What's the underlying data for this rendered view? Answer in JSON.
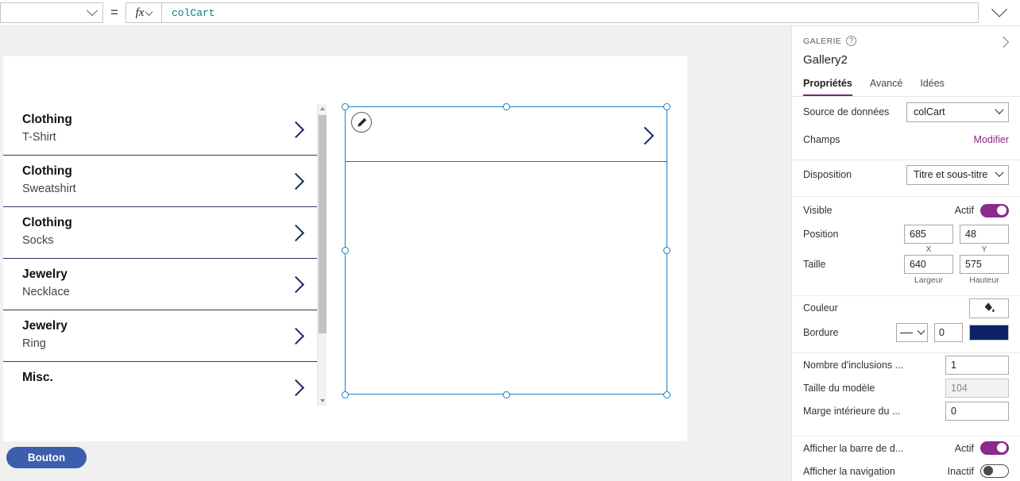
{
  "formula_bar": {
    "property_selector_value": "",
    "equals_sign": "=",
    "fx_label": "fx",
    "formula_value": "colCart",
    "expand_icon": "chevron-down-icon"
  },
  "canvas": {
    "gallery_items": [
      {
        "title": "Clothing",
        "subtitle": "T-Shirt"
      },
      {
        "title": "Clothing",
        "subtitle": "Sweatshirt"
      },
      {
        "title": "Clothing",
        "subtitle": "Socks"
      },
      {
        "title": "Jewelry",
        "subtitle": "Necklace"
      },
      {
        "title": "Jewelry",
        "subtitle": "Ring"
      },
      {
        "title": "Misc.",
        "subtitle": ""
      }
    ],
    "button_label": "Bouton",
    "selected_control": {
      "edit_icon": "pencil-edit-icon",
      "chevron_icon": "chevron-right-icon"
    }
  },
  "properties_panel": {
    "kicker": "GALERIE",
    "help_icon": "?",
    "title": "Gallery2",
    "collapse_icon": "chevron-right-icon",
    "tabs": [
      {
        "label": "Propriétés",
        "active": true
      },
      {
        "label": "Avancé",
        "active": false
      },
      {
        "label": "Idées",
        "active": false
      }
    ],
    "rows": {
      "data_source_label": "Source de données",
      "data_source_value": "colCart",
      "fields_label": "Champs",
      "fields_action": "Modifier",
      "layout_label": "Disposition",
      "layout_value": "Titre et sous-titre",
      "visible_label": "Visible",
      "visible_state": "Actif",
      "position_label": "Position",
      "position_x": "685",
      "position_y": "48",
      "position_x_sub": "X",
      "position_y_sub": "Y",
      "size_label": "Taille",
      "size_width": "640",
      "size_height": "575",
      "size_width_sub": "Largeur",
      "size_height_sub": "Hauteur",
      "color_label": "Couleur",
      "color_icon": "paint-bucket-icon",
      "border_label": "Bordure",
      "border_style": "solid-line",
      "border_width": "0",
      "border_color": "#0d2266",
      "wrap_count_label": "Nombre d'inclusions ...",
      "wrap_count_value": "1",
      "template_size_label": "Taille du modèle",
      "template_size_value": "104",
      "template_padding_label": "Marge intérieure du ...",
      "template_padding_value": "0",
      "show_scrollbar_label": "Afficher la barre de d...",
      "show_scrollbar_state": "Actif",
      "show_navigation_label": "Afficher la navigation",
      "show_navigation_state": "Inactif"
    }
  },
  "colors": {
    "accent_purple": "#8a2a8a",
    "selection_blue": "#1a7fc1",
    "app_button_blue": "#3c5fad",
    "gallery_divider": "#2b3a67",
    "formula_teal": "#0f7b7b"
  }
}
